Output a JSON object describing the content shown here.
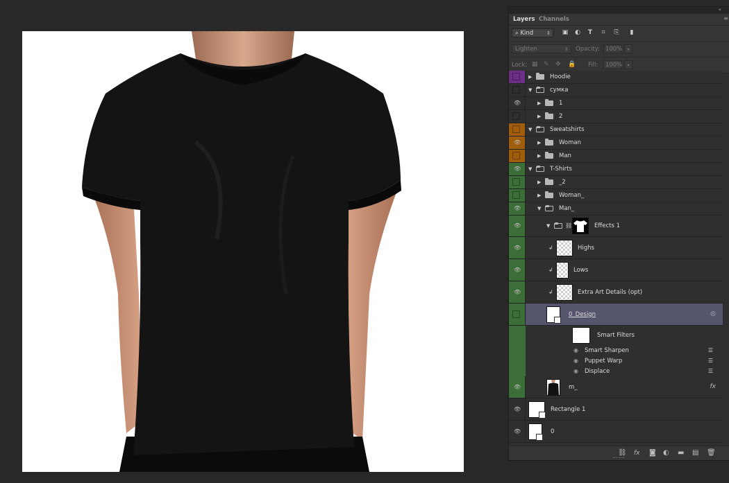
{
  "panel": {
    "tabs": [
      "Layers",
      "Channels"
    ],
    "collapse_glyph": "«",
    "menu_glyph": "≡",
    "filter": {
      "kind_label": "Kind",
      "icons": [
        "image-filter-icon",
        "adjustment-filter-icon",
        "type-filter-icon",
        "shape-filter-icon",
        "smart-object-filter-icon",
        "filter-toggle-icon"
      ]
    },
    "blend": {
      "mode": "Lighten",
      "opacity_label": "Opacity:",
      "opacity_value": "100%"
    },
    "lock": {
      "label": "Lock:",
      "fill_label": "Fill:",
      "fill_value": "100%"
    }
  },
  "layers": [
    {
      "name": "Hoodie",
      "kind": "group",
      "expanded": false,
      "indent": 0,
      "visible": false,
      "color": "#6b2f86"
    },
    {
      "name": "сумка",
      "kind": "group",
      "expanded": true,
      "indent": 0,
      "visible": false,
      "color": ""
    },
    {
      "name": "1",
      "kind": "group",
      "expanded": false,
      "indent": 1,
      "visible": true,
      "color": ""
    },
    {
      "name": "2",
      "kind": "group",
      "expanded": false,
      "indent": 1,
      "visible": false,
      "color": ""
    },
    {
      "name": "Sweatshirts",
      "kind": "group",
      "expanded": true,
      "indent": 0,
      "visible": false,
      "color": "#a05e0d"
    },
    {
      "name": "Woman",
      "kind": "group",
      "expanded": false,
      "indent": 1,
      "visible": true,
      "color": "#a05e0d"
    },
    {
      "name": "Man",
      "kind": "group",
      "expanded": false,
      "indent": 1,
      "visible": false,
      "color": "#a05e0d"
    },
    {
      "name": "T-Shirts",
      "kind": "group",
      "expanded": true,
      "indent": 0,
      "visible": true,
      "color": "#3c6e38"
    },
    {
      "name": "_2",
      "kind": "group",
      "expanded": false,
      "indent": 1,
      "visible": false,
      "color": "#3c6e38"
    },
    {
      "name": "Woman_",
      "kind": "group",
      "expanded": false,
      "indent": 1,
      "visible": false,
      "color": "#3c6e38"
    },
    {
      "name": "Man_",
      "kind": "group",
      "expanded": true,
      "indent": 1,
      "visible": true,
      "color": "#3c6e38"
    },
    {
      "name": "Effects 1",
      "kind": "masked-group",
      "expanded": true,
      "indent": 2,
      "visible": true,
      "color": "#3c6e38"
    },
    {
      "name": "Highs",
      "kind": "clipped",
      "indent": 3,
      "visible": true,
      "color": "#3c6e38"
    },
    {
      "name": "Lows",
      "kind": "clipped",
      "indent": 3,
      "visible": true,
      "color": "#3c6e38"
    },
    {
      "name": "Extra Art Details (opt)",
      "kind": "clipped",
      "indent": 3,
      "visible": true,
      "color": "#3c6e38"
    },
    {
      "name": "0_Design",
      "kind": "smart",
      "indent": 2,
      "visible": false,
      "color": "#3c6e38",
      "selected": true
    },
    {
      "name": "Smart Filters",
      "kind": "smart-filters",
      "indent": 3,
      "color": "#3c6e38"
    },
    {
      "name": "Smart Sharpen",
      "kind": "filter",
      "indent": 3,
      "color": "#3c6e38"
    },
    {
      "name": "Puppet Warp",
      "kind": "filter",
      "indent": 3,
      "color": "#3c6e38"
    },
    {
      "name": "Displace",
      "kind": "filter",
      "indent": 3,
      "color": "#3c6e38"
    },
    {
      "name": "m_",
      "kind": "photo",
      "indent": 2,
      "visible": true,
      "color": "#3c6e38",
      "fx": "fx"
    },
    {
      "name": "Rectangle 1",
      "kind": "smart",
      "indent": 0,
      "visible": true,
      "color": ""
    },
    {
      "name": "0",
      "kind": "smart",
      "indent": 0,
      "visible": true,
      "color": ""
    }
  ],
  "bottom_bar": {
    "icons": [
      "link-layers-icon",
      "fx-icon",
      "mask-icon",
      "adjustment-icon",
      "new-group-icon",
      "new-layer-icon",
      "trash-icon"
    ],
    "fx_label": "fx"
  },
  "colors": {
    "canvas_bg": "#ffffff",
    "shirt": "#111111",
    "skin": "#c9967a",
    "selection": "#55556e"
  }
}
